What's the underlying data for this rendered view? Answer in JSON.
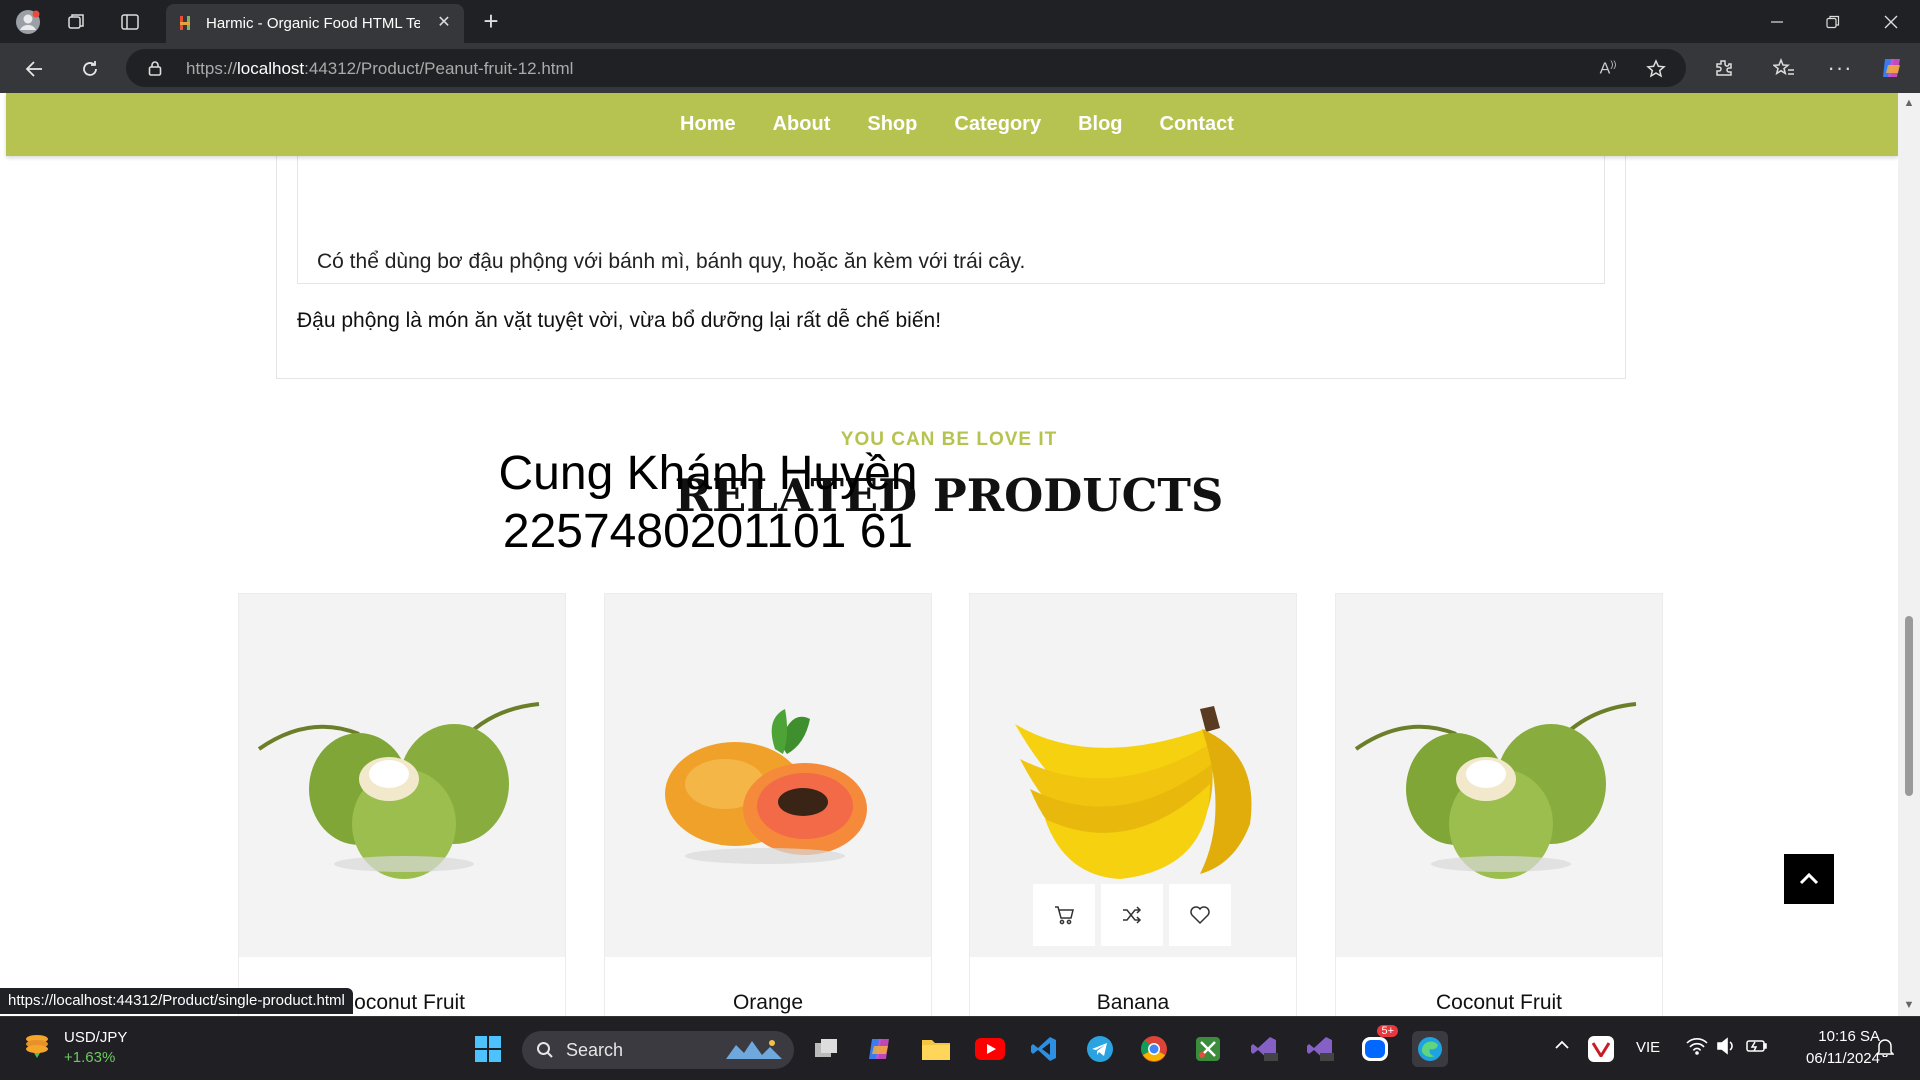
{
  "browser": {
    "tab_title": "Harmic - Organic Food HTML Tem",
    "url_prefix": "https://",
    "url_host": "localhost",
    "url_rest": ":44312/Product/Peanut-fruit-12.html",
    "status_url": "https://localhost:44312/Product/single-product.html"
  },
  "nav": {
    "items": [
      "Home",
      "About",
      "Shop",
      "Category",
      "Blog",
      "Contact"
    ]
  },
  "description": {
    "line1": "Có thể dùng bơ đậu phộng với bánh mì, bánh quy, hoặc ăn kèm với trái cây.",
    "line2": "Đậu phộng là món ăn vặt tuyệt vời, vừa bổ dưỡng lại rất dễ chế biến!"
  },
  "related": {
    "subtitle": "YOU CAN BE LOVE IT",
    "title": "RELATED PRODUCTS",
    "products": [
      {
        "name": "Coconut Fruit",
        "image": "coconut"
      },
      {
        "name": "Orange",
        "image": "papaya"
      },
      {
        "name": "Banana",
        "image": "banana"
      },
      {
        "name": "Coconut Fruit",
        "image": "coconut"
      }
    ]
  },
  "watermark": {
    "name": "Cung Khánh Huyền",
    "id": "2257480201101 61"
  },
  "taskbar": {
    "ticker_name": "USD/JPY",
    "ticker_change": "+1.63%",
    "search_label": "Search",
    "language": "VIE",
    "time": "10:16 SA",
    "date": "06/11/2024",
    "zalo_badge": "5+"
  },
  "colors": {
    "accent": "#b7c350",
    "chrome_dark": "#202124"
  }
}
